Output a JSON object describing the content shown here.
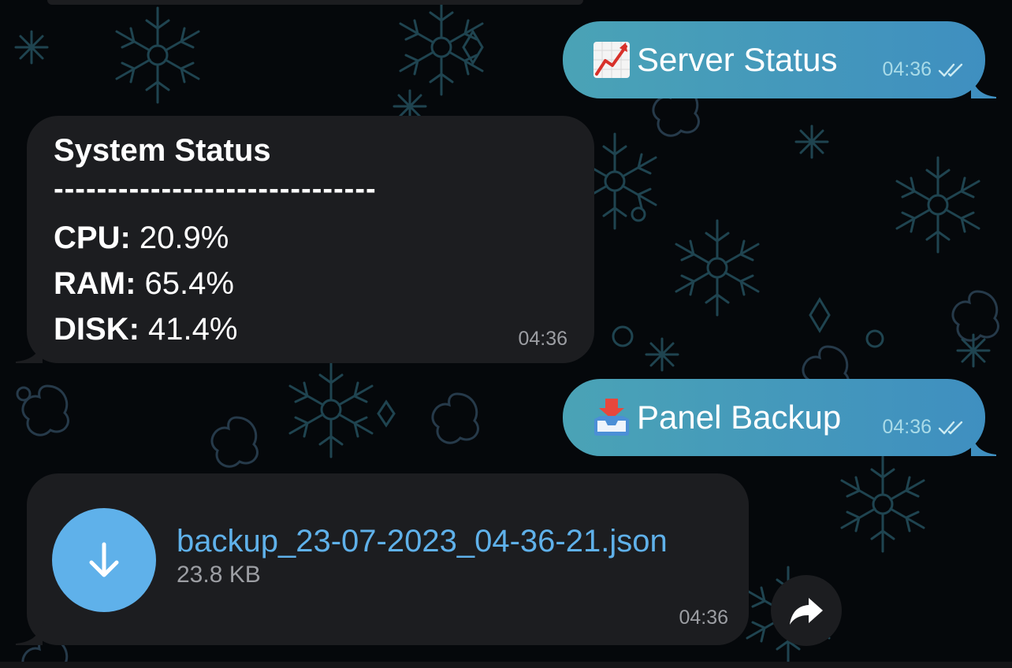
{
  "messages": {
    "server_status": {
      "emoji": "chart-increasing-icon",
      "text": "Server Status",
      "time": "04:36"
    },
    "system_status": {
      "title": "System Status",
      "divider": "------------------------------",
      "metrics": [
        {
          "label": "CPU:",
          "value": "20.9%"
        },
        {
          "label": "RAM:",
          "value": "65.4%"
        },
        {
          "label": "DISK:",
          "value": "41.4%"
        }
      ],
      "time": "04:36"
    },
    "panel_backup": {
      "emoji": "inbox-tray-icon",
      "text": "Panel Backup",
      "time": "04:36"
    },
    "file": {
      "name": "backup_23-07-2023_04-36-21.json",
      "size": "23.8 KB",
      "time": "04:36"
    }
  },
  "colors": {
    "outgoing_bubble_start": "#4aa3b6",
    "outgoing_bubble_end": "#3f8fc0",
    "incoming_bubble": "#1c1d20",
    "link": "#5fb1ea",
    "background": "#05080b"
  }
}
